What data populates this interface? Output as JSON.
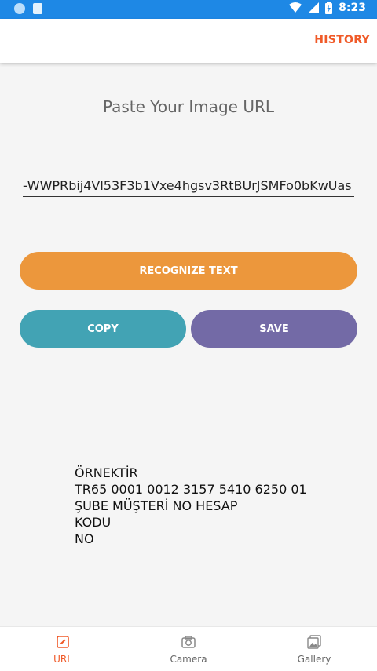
{
  "status_bar": {
    "time": "8:23"
  },
  "app_bar": {
    "history_label": "HISTORY",
    "accent_color": "#f05a28"
  },
  "main": {
    "title": "Paste Your Image URL",
    "url_value": "WWPRbij4Vl53F3b1Vxe4hgsv3RtBUrJSMFo0bKwUas-",
    "buttons": {
      "recognize_label": "RECOGNIZE TEXT",
      "copy_label": "COPY",
      "save_label": "SAVE"
    },
    "result_lines": [
      "ÖRNEKTİR",
      "TR65 0001 0012 3157 5410 6250 01",
      "ŞUBE MÜŞTERİ NO HESAP",
      "KODU",
      "NO"
    ]
  },
  "bottom_nav": {
    "items": [
      {
        "label": "URL",
        "icon": "edit-icon",
        "active": true
      },
      {
        "label": "Camera",
        "icon": "camera-icon",
        "active": false
      },
      {
        "label": "Gallery",
        "icon": "gallery-icon",
        "active": false
      }
    ]
  },
  "colors": {
    "status_bar": "#1e88e5",
    "recognize": "#ec973c",
    "copy": "#42a3b4",
    "save": "#736aa6"
  }
}
